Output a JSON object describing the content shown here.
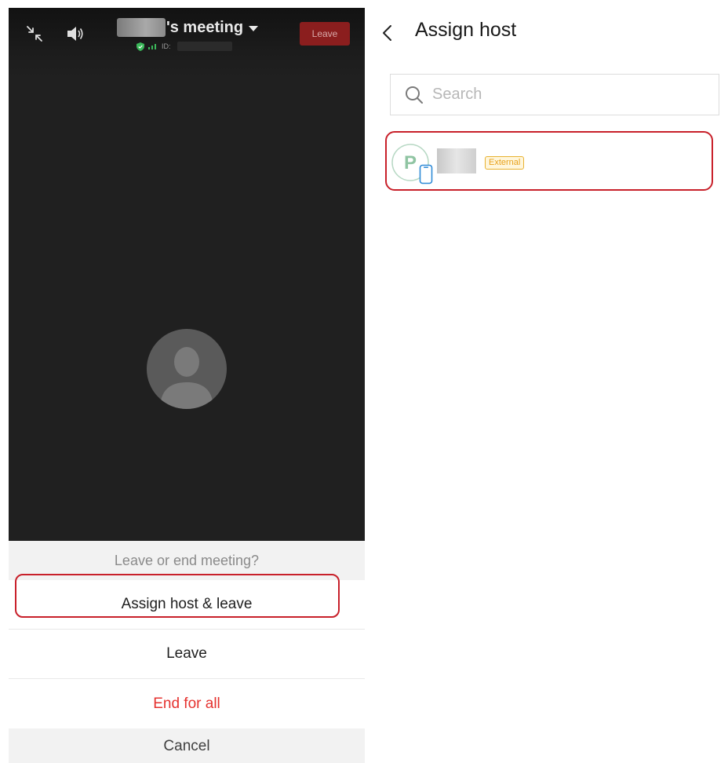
{
  "meeting": {
    "title_suffix": "'s meeting",
    "id_label": "ID:",
    "leave_label": "Leave"
  },
  "sheet": {
    "title": "Leave or end meeting?",
    "assign_host_leave": "Assign host & leave",
    "leave": "Leave",
    "end_for_all": "End for all",
    "cancel": "Cancel"
  },
  "assign_host": {
    "title": "Assign host",
    "search_placeholder": "Search",
    "participants": [
      {
        "avatar_letter": "P",
        "badge": "External"
      }
    ]
  },
  "colors": {
    "highlight": "#c8202a",
    "end_for_all": "#e5322f",
    "external_badge": "#e8a21d",
    "leave_button": "#8b1e1e"
  },
  "icons": [
    "minimize-icon",
    "speaker-icon",
    "dropdown-caret-icon",
    "shield-icon",
    "signal-icon",
    "default-avatar-icon",
    "back-chevron-icon",
    "search-icon",
    "participant-avatar-icon",
    "mobile-device-icon"
  ]
}
